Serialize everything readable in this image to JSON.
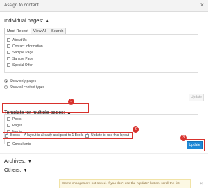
{
  "window": {
    "title": "Assign to content",
    "close_glyph": "×"
  },
  "individual": {
    "heading": "Individual pages:",
    "tabs": [
      "Most Recent",
      "View All",
      "Search"
    ],
    "active_tab": 0,
    "items": [
      {
        "label": "About Us",
        "checked": false
      },
      {
        "label": "Contact Information",
        "checked": false
      },
      {
        "label": "Sample Page",
        "checked": false
      },
      {
        "label": "Sample Page",
        "checked": false
      },
      {
        "label": "Special Offer",
        "checked": false
      }
    ],
    "radios": [
      {
        "label": "Show only pages",
        "selected": true
      },
      {
        "label": "Show all content types",
        "selected": false
      }
    ],
    "update_label": "Update"
  },
  "template": {
    "heading": "Template for multiple pages:",
    "items": [
      {
        "label": "Posts",
        "checked": false
      },
      {
        "label": "Pages",
        "checked": false
      },
      {
        "label": "Media",
        "checked": false
      }
    ],
    "books_label": "Books",
    "books_note": "A layout is already assigned to 1 Book.",
    "update_layout_label": "Update to use this layout",
    "consultants_label": "Consultants",
    "update_label": "Update"
  },
  "archives": {
    "heading": "Archives:"
  },
  "others": {
    "heading": "Others:"
  },
  "notice": {
    "text": "Some changes are not saved. If you don't use the \"update\" button, scroll the list.",
    "close_glyph": "×"
  },
  "badges": [
    "1",
    "2",
    "3"
  ],
  "colors": {
    "accent_red": "#d8322d",
    "primary_blue": "#1e88d6",
    "notice_bg": "#fcf8e3"
  }
}
